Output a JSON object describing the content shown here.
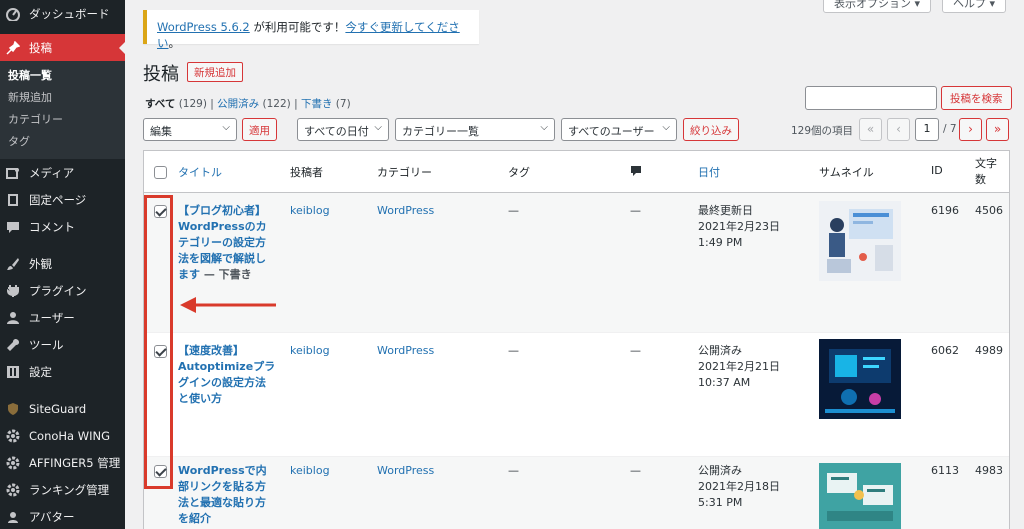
{
  "sidebar": {
    "items": [
      {
        "label": "ダッシュボード",
        "icon": "dashboard-icon"
      },
      {
        "label": "投稿",
        "icon": "pin-icon",
        "active": true
      },
      {
        "label": "メディア",
        "icon": "media-icon"
      },
      {
        "label": "固定ページ",
        "icon": "page-icon"
      },
      {
        "label": "コメント",
        "icon": "comment-icon"
      },
      {
        "label": "外観",
        "icon": "brush-icon"
      },
      {
        "label": "プラグイン",
        "icon": "plugin-icon"
      },
      {
        "label": "ユーザー",
        "icon": "user-icon"
      },
      {
        "label": "ツール",
        "icon": "wrench-icon"
      },
      {
        "label": "設定",
        "icon": "settings-icon"
      },
      {
        "label": "SiteGuard",
        "icon": "siteguard-icon"
      },
      {
        "label": "ConoHa WING",
        "icon": "gear-icon"
      },
      {
        "label": "AFFINGER5 管理",
        "icon": "gear-icon"
      },
      {
        "label": "ランキング管理",
        "icon": "gear-icon"
      },
      {
        "label": "アバター",
        "icon": "avatar-icon"
      }
    ],
    "submenu": [
      "投稿一覧",
      "新規追加",
      "カテゴリー",
      "タグ"
    ]
  },
  "header": {
    "screen_options": "表示オプション ▾",
    "help": "ヘルプ ▾"
  },
  "notice": {
    "version_link": "WordPress 5.6.2",
    "middle": " が利用可能です！",
    "update_link": "今すぐ更新してください",
    "end": "。"
  },
  "page": {
    "title": "投稿",
    "add_new": "新規追加"
  },
  "filters": {
    "all": "すべて",
    "all_count": "(129)",
    "sep1": " | ",
    "published": "公開済み",
    "published_count": "(122)",
    "sep2": " | ",
    "draft": "下書き",
    "draft_count": "(7)"
  },
  "search": {
    "placeholder": "",
    "button": "投稿を検索"
  },
  "toolbar": {
    "bulk_action": "編集",
    "apply": "適用",
    "dates": "すべての日付",
    "categories": "カテゴリー一覧",
    "users": "すべてのユーザー",
    "filter": "絞り込み",
    "items_count": "129個の項目",
    "first": "«",
    "prev": "‹",
    "current_page": "1",
    "total_pages": "/ 7",
    "next": "›",
    "last": "»"
  },
  "table": {
    "headers": {
      "title": "タイトル",
      "author": "投稿者",
      "category": "カテゴリー",
      "tags": "タグ",
      "date": "日付",
      "thumbnail": "サムネイル",
      "id": "ID",
      "chars": "文字数"
    },
    "rows": [
      {
        "title": "【ブログ初心者】WordPressのカテゴリーの設定方法を図解で解説します",
        "state": " — 下書き",
        "author": "keiblog",
        "category": "WordPress",
        "tags": "—",
        "comments": "—",
        "date_status": "最終更新日",
        "date_value": "2021年2月23日 1:49 PM",
        "id": "6196",
        "chars": "4506",
        "checked": true
      },
      {
        "title": "【速度改善】Autoptimizeプラグインの設定方法と使い方",
        "state": "",
        "author": "keiblog",
        "category": "WordPress",
        "tags": "—",
        "comments": "—",
        "date_status": "公開済み",
        "date_value": "2021年2月21日 10:37 AM",
        "id": "6062",
        "chars": "4989",
        "checked": true
      },
      {
        "title": "WordPressで内部リンクを貼る方法と最適な貼り方を紹介",
        "state": "",
        "author": "keiblog",
        "category": "WordPress",
        "tags": "—",
        "comments": "—",
        "date_status": "公開済み",
        "date_value": "2021年2月18日 5:31 PM",
        "id": "6113",
        "chars": "4983",
        "checked": true
      }
    ]
  },
  "colors": {
    "sidebar_bg": "#1d2327",
    "accent_red": "#d63638",
    "link_blue": "#2271b1",
    "annotation_red": "#d93a2b"
  }
}
